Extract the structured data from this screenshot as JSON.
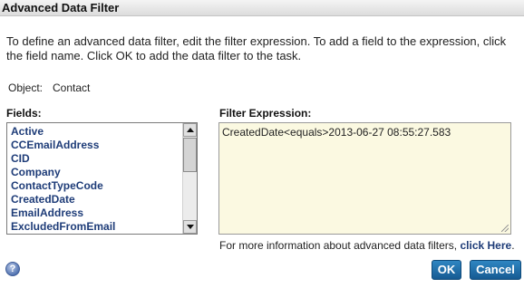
{
  "dialog": {
    "title": "Advanced Data Filter",
    "instructions": "To define an advanced data filter, edit the filter expression. To add a field to the expression, click the field name. Click OK to add the data filter to the task.",
    "object_label": "Object:",
    "object_value": "Contact"
  },
  "fields": {
    "label": "Fields:",
    "items": [
      "Active",
      "CCEmailAddress",
      "CID",
      "Company",
      "ContactTypeCode",
      "CreatedDate",
      "EmailAddress",
      "ExcludedFromEmail"
    ]
  },
  "filter": {
    "label": "Filter Expression:",
    "expression": "CreatedDate<equals>2013-06-27 08:55:27.583"
  },
  "more_info": {
    "text": "For more information about advanced data filters, ",
    "link": "click Here",
    "suffix": "."
  },
  "buttons": {
    "ok": "OK",
    "cancel": "Cancel"
  },
  "icons": {
    "help": "question-mark-icon"
  }
}
